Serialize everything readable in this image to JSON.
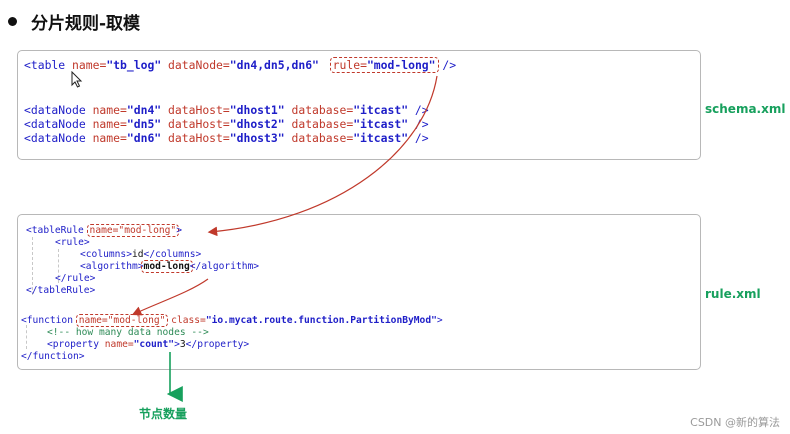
{
  "heading": "分片规则-取模",
  "schema": {
    "file_label": "schema.xml",
    "table_line": {
      "open": "<table ",
      "name_attr": "name=",
      "name_val": "\"tb_log\"",
      "datanode_attr": " dataNode=",
      "datanode_val": "\"dn4,dn5,dn6\"",
      "rule_attr": "rule=",
      "rule_val": "\"mod-long\"",
      "close": " />"
    },
    "datanodes": [
      {
        "name": "\"dn4\"",
        "host": "\"dhost1\"",
        "db": "\"itcast\""
      },
      {
        "name": "\"dn5\"",
        "host": "\"dhost2\"",
        "db": "\"itcast\""
      },
      {
        "name": "\"dn6\"",
        "host": "\"dhost3\"",
        "db": "\"itcast\""
      }
    ],
    "dn_open": "<dataNode ",
    "dn_name_attr": "name=",
    "dn_host_attr": " dataHost=",
    "dn_db_attr": " database=",
    "dn_close": " />"
  },
  "rule": {
    "file_label": "rule.xml",
    "tablerule_open": "<tableRule ",
    "tablerule_name": "name=\"mod-long\"",
    "tablerule_gt": ">",
    "rule_open": "<rule>",
    "columns_open": "<columns>",
    "columns_val": "id",
    "columns_close": "</columns>",
    "algorithm_open": "<algorithm>",
    "algorithm_val": "mod-long",
    "algorithm_close": "</algorithm>",
    "rule_close": "</rule>",
    "tablerule_close": "</tableRule>",
    "function_open": "<function ",
    "function_name": "name=\"mod-long\"",
    "function_class_attr": " class=",
    "function_class_val": "\"io.mycat.route.function.PartitionByMod\"",
    "function_gt": ">",
    "comment": "<!-- how many data nodes -->",
    "property_open": "<property ",
    "property_name_attr": "name=",
    "property_name_val": "\"count\"",
    "property_gt": ">",
    "property_val": "3",
    "property_close": "</property>",
    "function_close": "</function>"
  },
  "caption": "节点数量",
  "watermark": "CSDN @新的算法",
  "colors": {
    "tag": "#1e1ec8",
    "attr": "#c0392b",
    "highlight": "#c0392b",
    "label": "#17a05d"
  }
}
